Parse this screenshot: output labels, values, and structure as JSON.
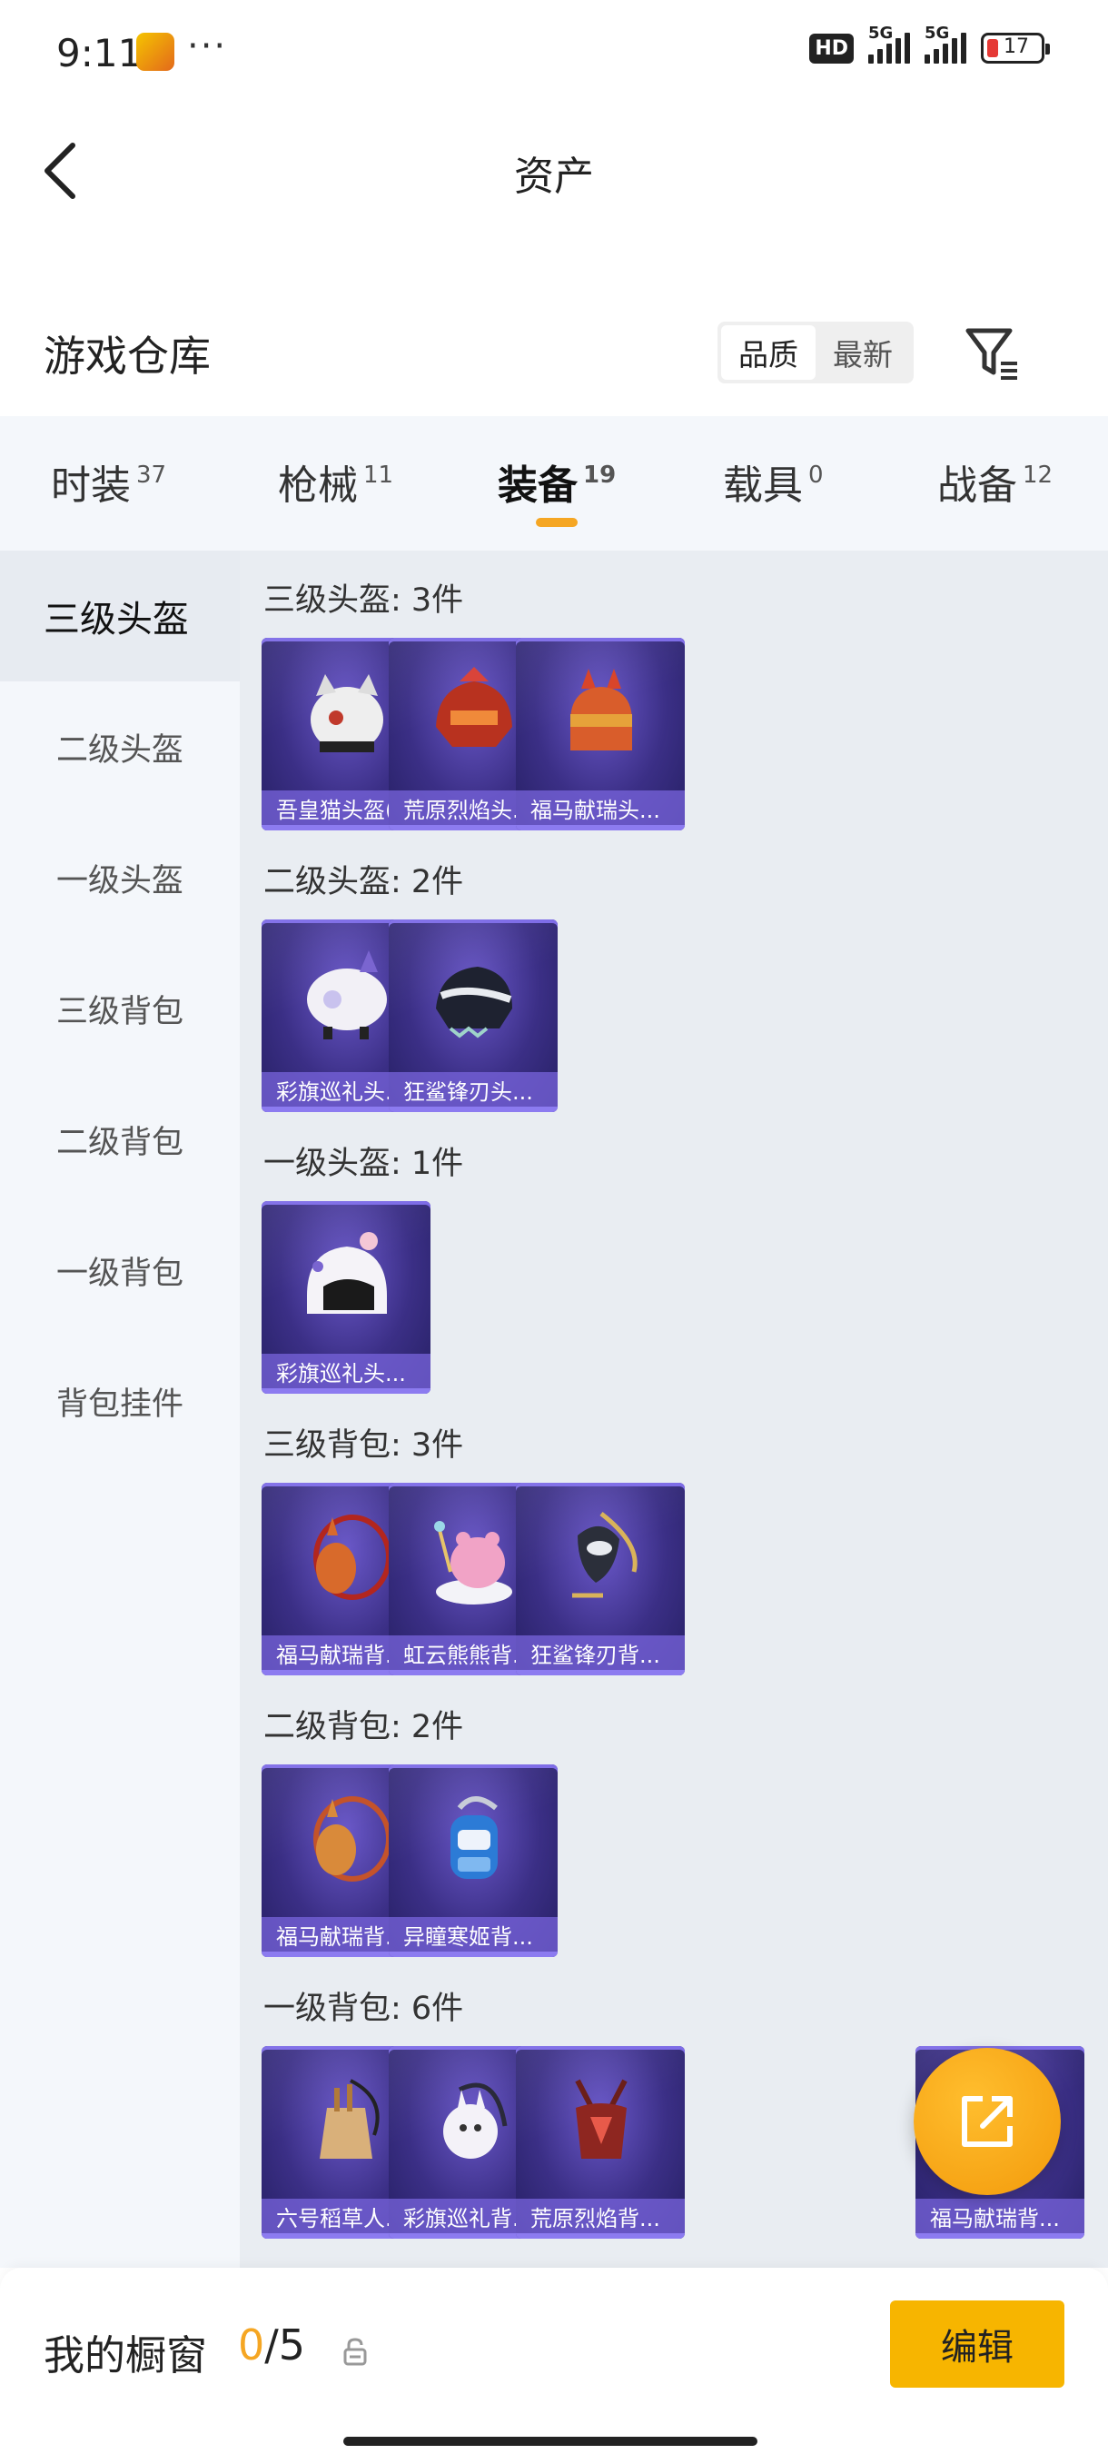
{
  "status_bar": {
    "time": "9:11",
    "dots": "···",
    "hd": "HD",
    "network1": "5G",
    "network2": "5G",
    "battery": "17"
  },
  "nav": {
    "title": "资产"
  },
  "warehouse": {
    "title": "游戏仓库",
    "sort_options": [
      "品质",
      "最新"
    ]
  },
  "tabs": [
    {
      "label": "时装",
      "count": "37"
    },
    {
      "label": "枪械",
      "count": "11"
    },
    {
      "label": "装备",
      "count": "19"
    },
    {
      "label": "载具",
      "count": "0"
    },
    {
      "label": "战备",
      "count": "12"
    }
  ],
  "sidebar": {
    "items": [
      "三级头盔",
      "二级头盔",
      "一级头盔",
      "三级背包",
      "二级背包",
      "一级背包",
      "背包挂件"
    ]
  },
  "sections": [
    {
      "title": "三级头盔: 3件",
      "items": [
        "吾皇猫头盔(...",
        "荒原烈焰头...",
        "福马献瑞头..."
      ]
    },
    {
      "title": "二级头盔: 2件",
      "items": [
        "彩旗巡礼头...",
        "狂鲨锋刃头..."
      ]
    },
    {
      "title": "一级头盔: 1件",
      "items": [
        "彩旗巡礼头..."
      ]
    },
    {
      "title": "三级背包: 3件",
      "items": [
        "福马献瑞背...",
        "虹云熊熊背...",
        "狂鲨锋刃背..."
      ]
    },
    {
      "title": "二级背包: 2件",
      "items": [
        "福马献瑞背...",
        "异瞳寒姬背..."
      ]
    },
    {
      "title": "一级背包: 6件",
      "items": [
        "六号稻草人...",
        "彩旗巡礼背...",
        "荒原烈焰背...",
        "福马献瑞背..."
      ]
    }
  ],
  "bottom_bar": {
    "showcase_label": "我的橱窗",
    "showcase_current": "0",
    "showcase_total": "/5",
    "edit_label": "编辑"
  },
  "colors": {
    "accent": "#f5a623",
    "edit_button": "#f7b500",
    "card_bg": "#3b2f86"
  }
}
